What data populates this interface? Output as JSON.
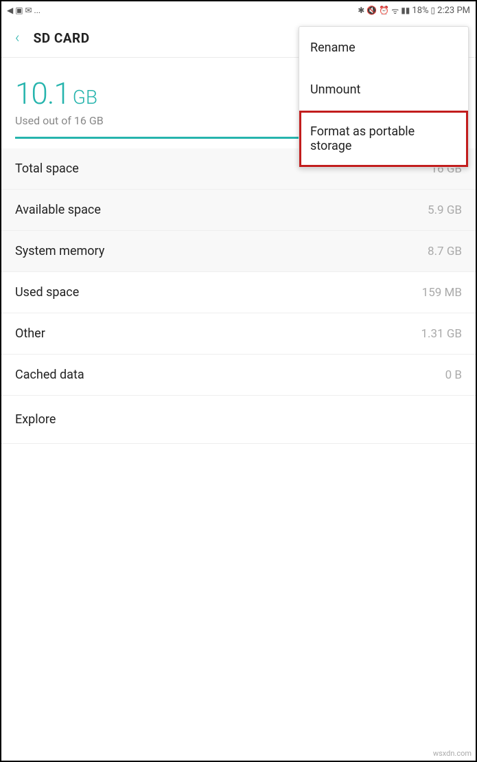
{
  "status_bar": {
    "left_icons": "◀ ▣ ✉ ...",
    "bluetooth": "✱",
    "mute": "🔇",
    "alarm": "⏰",
    "wifi": "ᯤ",
    "signal": "▮▮",
    "battery_percent": "18%",
    "battery_icon": "▯",
    "time": "2:23 PM"
  },
  "header": {
    "title": "SD CARD"
  },
  "usage": {
    "value": "10.1",
    "unit": "GB",
    "subtitle": "Used out of 16 GB"
  },
  "rows": {
    "total_space": {
      "label": "Total space",
      "value": "16 GB"
    },
    "available_space": {
      "label": "Available space",
      "value": "5.9 GB"
    },
    "system_memory": {
      "label": "System memory",
      "value": "8.7 GB"
    },
    "used_space": {
      "label": "Used space",
      "value": "159 MB"
    },
    "other": {
      "label": "Other",
      "value": "1.31 GB"
    },
    "cached_data": {
      "label": "Cached data",
      "value": "0 B"
    },
    "explore": {
      "label": "Explore"
    }
  },
  "menu": {
    "rename": "Rename",
    "unmount": "Unmount",
    "format": "Format as portable storage"
  },
  "watermark": "wsxdn.com"
}
